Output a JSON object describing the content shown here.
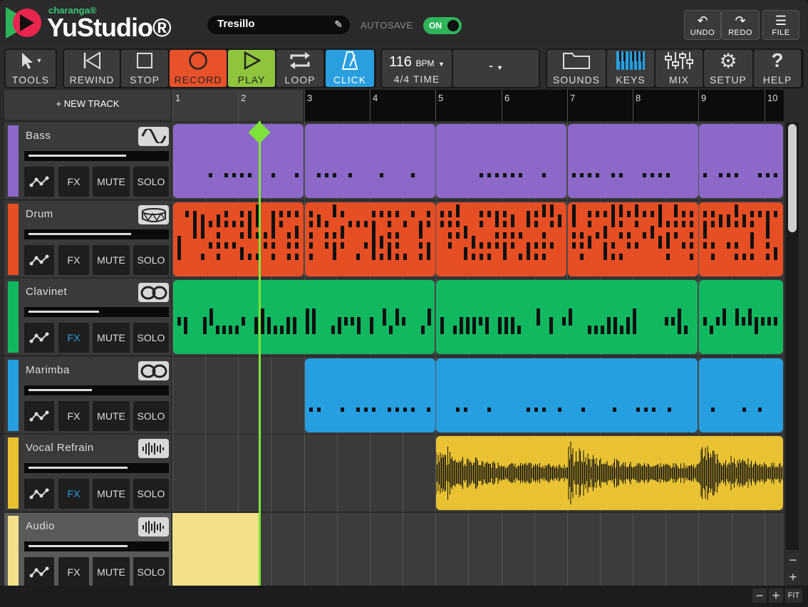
{
  "brand": {
    "small": "charanga®",
    "big": "YuStudio®"
  },
  "project": {
    "name": "Tresillo"
  },
  "autosave": {
    "label": "AUTOSAVE",
    "state": "ON"
  },
  "header_buttons": {
    "undo": "UNDO",
    "redo": "REDO",
    "file": "FILE"
  },
  "toolbar": {
    "tools": "TOOLS",
    "rewind": "REWIND",
    "stop": "STOP",
    "record": "RECORD",
    "play": "PLAY",
    "loop": "LOOP",
    "click": "CLICK",
    "bpm_value": "116",
    "bpm_unit": "BPM",
    "time_sig": "4/4 TIME",
    "key_value": "-",
    "sounds": "SOUNDS",
    "keys": "KEYS",
    "mix": "MIX",
    "setup": "SETUP",
    "help": "HELP"
  },
  "new_track": "+ NEW TRACK",
  "ruler": {
    "bars": [
      "1",
      "2",
      "3",
      "4",
      "5",
      "6",
      "7",
      "8",
      "9",
      "10"
    ]
  },
  "buttons": {
    "fx": "FX",
    "mute": "MUTE",
    "solo": "SOLO"
  },
  "tracks": [
    {
      "name": "Bass",
      "color": "#8c68c9",
      "icon": "sine-wave-icon",
      "volume": 0.72
    },
    {
      "name": "Drum",
      "color": "#e64e24",
      "icon": "drum-icon",
      "volume": 0.76
    },
    {
      "name": "Clavinet",
      "color": "#12b860",
      "icon": "loop-icon",
      "volume": 0.52
    },
    {
      "name": "Marimba",
      "color": "#269fe0",
      "icon": "loop-icon",
      "volume": 0.47
    },
    {
      "name": "Vocal Refrain",
      "color": "#e8c232",
      "icon": "audio-wave-icon",
      "volume": 0.73
    },
    {
      "name": "Audio",
      "color": "#f2df8a",
      "icon": "audio-wave-icon",
      "volume": 0.73
    }
  ],
  "zoom": {
    "minus": "−",
    "plus": "+",
    "fit": "FIT"
  },
  "colors": {
    "playhead": "#7ee23a",
    "record": "#e8522a",
    "play": "#8fc43c",
    "click": "#2a9fe0",
    "autosave": "#2fb45a"
  }
}
